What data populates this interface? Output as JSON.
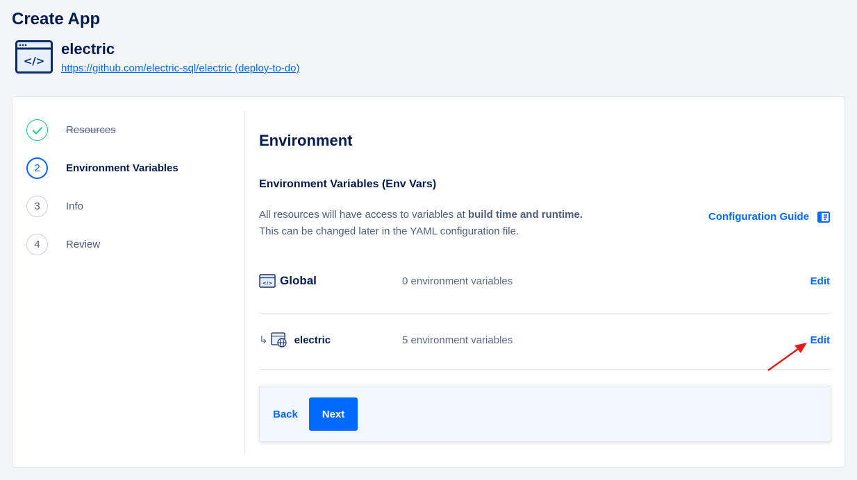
{
  "page": {
    "title": "Create App"
  },
  "app": {
    "name": "electric",
    "repo_link": "https://github.com/electric-sql/electric (deploy-to-do)",
    "icon": "code-window-icon"
  },
  "steps": [
    {
      "number": "",
      "label": "Resources",
      "state": "done"
    },
    {
      "number": "2",
      "label": "Environment Variables",
      "state": "active"
    },
    {
      "number": "3",
      "label": "Info",
      "state": "pending"
    },
    {
      "number": "4",
      "label": "Review",
      "state": "pending"
    }
  ],
  "main": {
    "section_title": "Environment",
    "sub_title": "Environment Variables (Env Vars)",
    "desc_line1_prefix": "All resources will have access to variables at ",
    "desc_line1_bold": "build time and runtime.",
    "desc_line2": "This can be changed later in the YAML configuration file.",
    "config_guide": "Configuration Guide",
    "rows": [
      {
        "name": "Global",
        "count": "0 environment variables",
        "edit": "Edit"
      },
      {
        "prefix": "↳",
        "name": "electric",
        "count": "5 environment variables",
        "edit": "Edit"
      }
    ]
  },
  "footer": {
    "back": "Back",
    "next": "Next"
  },
  "colors": {
    "accent": "#0069ff",
    "success": "#15cd72",
    "text": "#031b4e",
    "annotation": "#e01b1b"
  }
}
